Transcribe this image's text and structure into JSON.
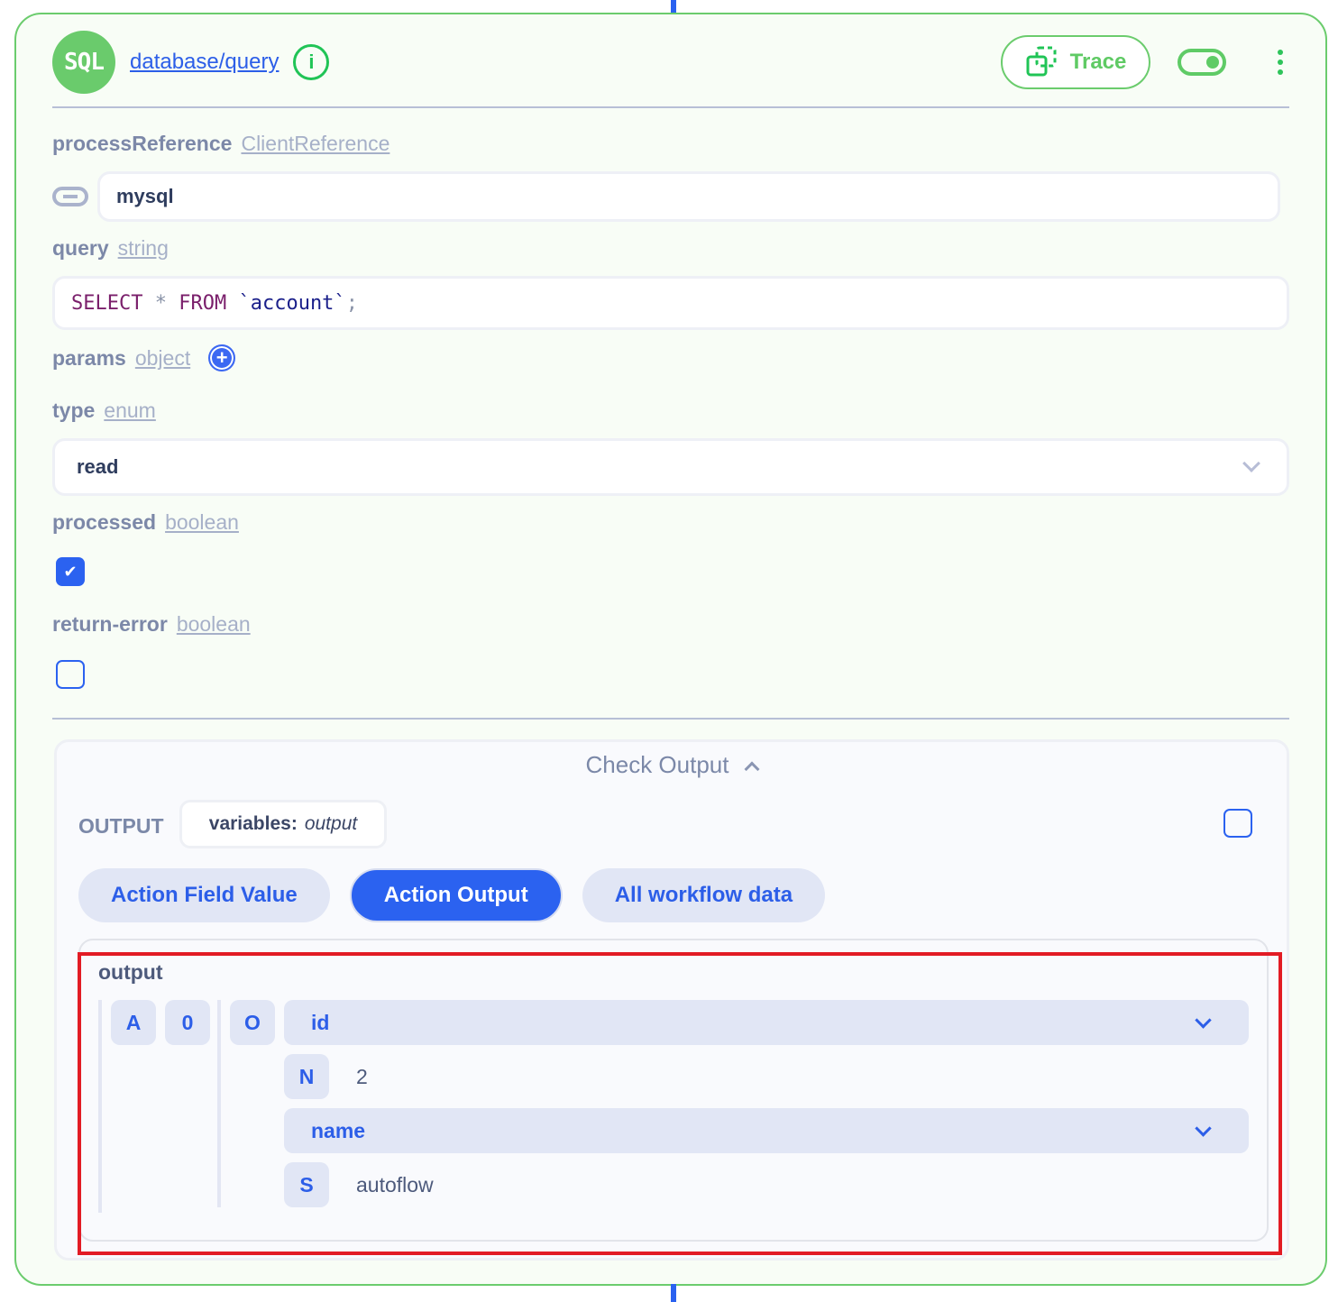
{
  "header": {
    "badge": "SQL",
    "action_name": "database/query",
    "info_icon": "info-icon",
    "trace_label": "Trace",
    "trace_icon": "trace-icon",
    "toggle_on": true,
    "menu_icon": "kebab-menu-icon"
  },
  "fields": {
    "processReference": {
      "name": "processReference",
      "type": "ClientReference",
      "value": "mysql",
      "icon": "link-icon"
    },
    "query": {
      "name": "query",
      "type": "string",
      "tokens": [
        "SELECT",
        "*",
        "FROM",
        "`account`",
        ";"
      ]
    },
    "params": {
      "name": "params",
      "type": "object",
      "add_icon": "plus-circle-icon"
    },
    "type": {
      "name": "type",
      "type": "enum",
      "value": "read"
    },
    "processed": {
      "name": "processed",
      "type": "boolean",
      "checked": true
    },
    "return_error": {
      "name": "return-error",
      "type": "boolean",
      "checked": false
    }
  },
  "output": {
    "toggle_label": "Check Output",
    "label": "OUTPUT",
    "variables_key": "variables:",
    "variables_value": "output",
    "tabs": [
      {
        "label": "Action Field Value",
        "active": false
      },
      {
        "label": "Action Output",
        "active": true
      },
      {
        "label": "All workflow data",
        "active": false
      }
    ],
    "tree": {
      "title": "output",
      "array_chip": "A",
      "index_chip": "0",
      "object_chip": "O",
      "entries": [
        {
          "key": "id",
          "type_chip": "N",
          "value": "2"
        },
        {
          "key": "name",
          "type_chip": "S",
          "value": "autoflow"
        }
      ]
    }
  },
  "colors": {
    "accent_green": "#6bcc6d",
    "accent_blue": "#2b62f0",
    "highlight_red": "#e21b24"
  }
}
